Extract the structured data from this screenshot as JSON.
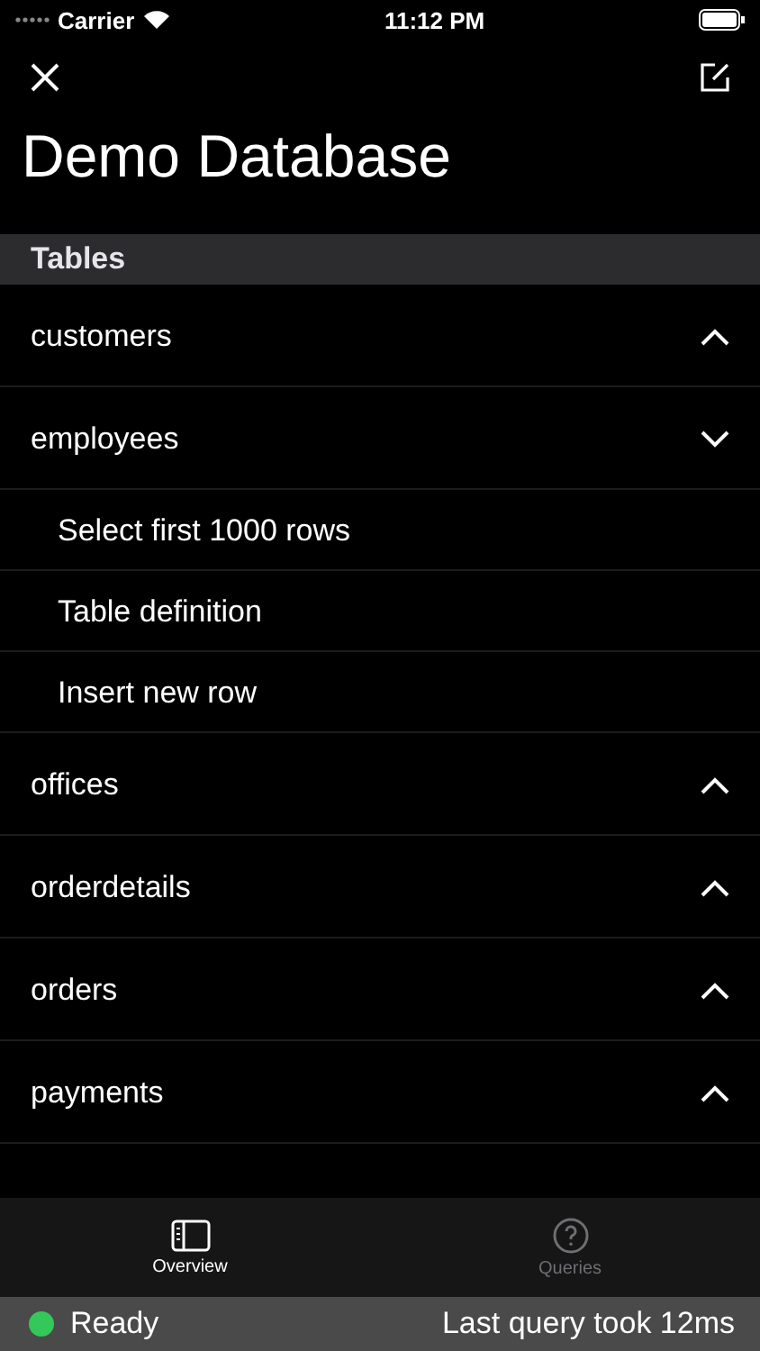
{
  "status_bar": {
    "carrier": "Carrier",
    "time": "11:12 PM"
  },
  "title": "Demo Database",
  "section": "Tables",
  "tables": [
    {
      "name": "customers",
      "expanded": false
    },
    {
      "name": "employees",
      "expanded": true,
      "actions": [
        "Select first 1000 rows",
        "Table definition",
        "Insert new row"
      ]
    },
    {
      "name": "offices",
      "expanded": false
    },
    {
      "name": "orderdetails",
      "expanded": false
    },
    {
      "name": "orders",
      "expanded": false
    },
    {
      "name": "payments",
      "expanded": false
    }
  ],
  "tabs": [
    {
      "label": "Overview",
      "selected": true,
      "kind": "overview"
    },
    {
      "label": "Queries",
      "selected": false,
      "kind": "queries"
    }
  ],
  "footer": {
    "status": "Ready",
    "color": "#34c759",
    "message": "Last query took 12ms"
  }
}
